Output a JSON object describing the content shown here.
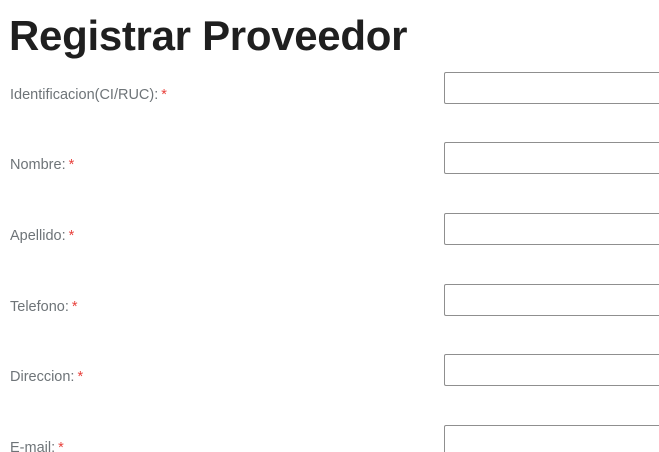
{
  "page": {
    "title": "Registrar Proveedor"
  },
  "form": {
    "required_marker": "*",
    "fields": [
      {
        "label": "Identificacion(CI/RUC):",
        "value": "",
        "placeholder": ""
      },
      {
        "label": "Nombre:",
        "value": "",
        "placeholder": ""
      },
      {
        "label": "Apellido:",
        "value": "",
        "placeholder": ""
      },
      {
        "label": "Telefono:",
        "value": "",
        "placeholder": ""
      },
      {
        "label": "Direccion:",
        "value": "",
        "placeholder": ""
      },
      {
        "label": "E-mail:",
        "value": "",
        "placeholder": ""
      }
    ]
  },
  "colors": {
    "title": "#1f1f1f",
    "label": "#6e7478",
    "required": "#e8413c",
    "input_border": "#8f8f8f"
  }
}
